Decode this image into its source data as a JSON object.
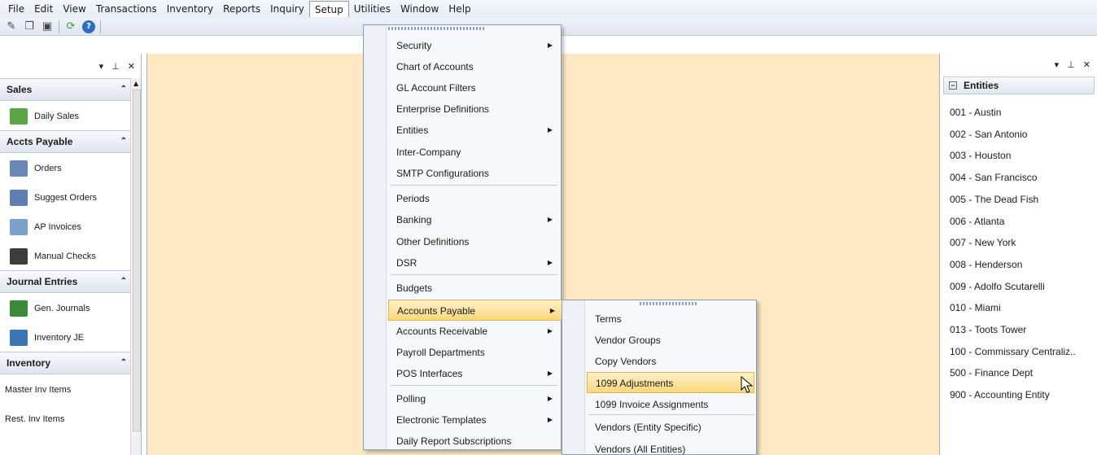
{
  "menubar": {
    "items": [
      "File",
      "Edit",
      "View",
      "Transactions",
      "Inventory",
      "Reports",
      "Inquiry",
      "Setup",
      "Utilities",
      "Window",
      "Help"
    ],
    "active": "Setup"
  },
  "toolbar": {
    "icons": [
      "tools-icon",
      "copy-icon",
      "paste-icon",
      "refresh-icon",
      "help-icon"
    ]
  },
  "left_panel": {
    "sections": [
      {
        "title": "Sales",
        "items": [
          {
            "label": "Daily Sales",
            "icon": "daily-sales-icon",
            "color": "#5aa545"
          }
        ]
      },
      {
        "title": "Accts Payable",
        "items": [
          {
            "label": "Orders",
            "icon": "orders-icon",
            "color": "#6a87b8"
          },
          {
            "label": "Suggest Orders",
            "icon": "suggest-orders-icon",
            "color": "#5f7fb3"
          },
          {
            "label": "AP Invoices",
            "icon": "ap-invoices-icon",
            "color": "#7aa0cc"
          },
          {
            "label": "Manual Checks",
            "icon": "manual-checks-icon",
            "color": "#3d3d3d"
          }
        ]
      },
      {
        "title": "Journal Entries",
        "items": [
          {
            "label": "Gen. Journals",
            "icon": "gen-journals-icon",
            "color": "#3a8a3a"
          },
          {
            "label": "Inventory JE",
            "icon": "inventory-je-icon",
            "color": "#3a76b5"
          }
        ]
      },
      {
        "title": "Inventory",
        "items": [
          {
            "label": "Master Inv Items",
            "icon": "",
            "color": ""
          },
          {
            "label": "Rest. Inv Items",
            "icon": "",
            "color": ""
          }
        ]
      }
    ]
  },
  "right_panel": {
    "header": "Entities",
    "entities": [
      "001 - Austin",
      "002 - San Antonio",
      "003 - Houston",
      "004 - San Francisco",
      "005 - The Dead Fish",
      "006 - Atlanta",
      "007 - New York",
      "008 - Henderson",
      "009 - Adolfo Scutarelli",
      "010 - Miami",
      "013 - Toots Tower",
      "100 - Commissary Centraliz..",
      "500 - Finance Dept",
      "900 - Accounting Entity"
    ]
  },
  "setup_menu": {
    "items": [
      {
        "label": "Security",
        "submenu": true
      },
      {
        "label": "Chart of Accounts",
        "submenu": false
      },
      {
        "label": "GL Account Filters",
        "submenu": false
      },
      {
        "label": "Enterprise Definitions",
        "submenu": false
      },
      {
        "label": "Entities",
        "submenu": true
      },
      {
        "label": "Inter-Company",
        "submenu": false
      },
      {
        "label": "SMTP Configurations",
        "submenu": false
      },
      {
        "label": "Periods",
        "submenu": false
      },
      {
        "label": "Banking",
        "submenu": true
      },
      {
        "label": "Other Definitions",
        "submenu": false
      },
      {
        "label": "DSR",
        "submenu": true
      },
      {
        "label": "Budgets",
        "submenu": false
      },
      {
        "label": "Accounts Payable",
        "submenu": true
      },
      {
        "label": "Accounts Receivable",
        "submenu": true
      },
      {
        "label": "Payroll Departments",
        "submenu": false
      },
      {
        "label": "POS Interfaces",
        "submenu": true
      },
      {
        "label": "Polling",
        "submenu": true
      },
      {
        "label": "Electronic Templates",
        "submenu": true
      },
      {
        "label": "Daily Report Subscriptions",
        "submenu": false
      }
    ],
    "highlighted": "Accounts Payable"
  },
  "accounts_payable_submenu": {
    "items": [
      "Terms",
      "Vendor Groups",
      "Copy Vendors",
      "1099 Adjustments",
      "1099 Invoice Assignments",
      "Vendors (Entity Specific)",
      "Vendors (All Entities)"
    ],
    "highlighted": "1099 Adjustments"
  }
}
